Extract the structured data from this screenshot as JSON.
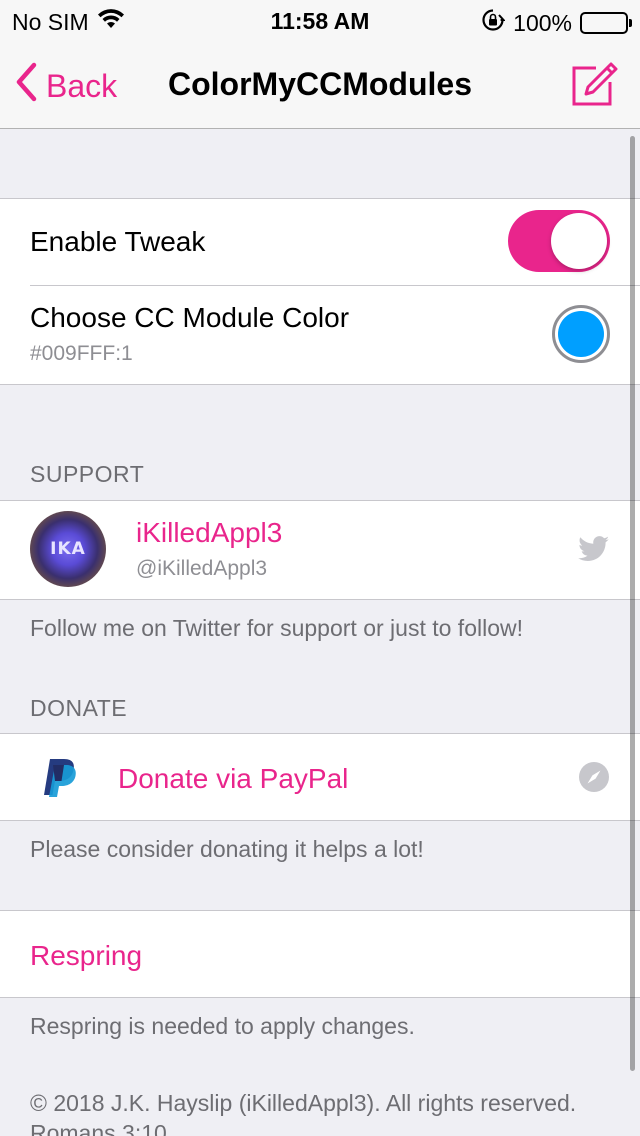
{
  "status_bar": {
    "carrier": "No SIM",
    "time": "11:58 AM",
    "battery": "100%"
  },
  "nav": {
    "back_label": "Back",
    "title": "ColorMyCCModules"
  },
  "settings": {
    "enable_label": "Enable Tweak",
    "enable_on": true,
    "color_label": "Choose CC Module Color",
    "color_value": "#009FFF:1",
    "swatch_color": "#009FFF"
  },
  "support": {
    "header": "SUPPORT",
    "avatar_text": "IKA",
    "name": "iKilledAppl3",
    "handle": "@iKilledAppl3",
    "footer": "Follow me on Twitter for support or just to follow!"
  },
  "donate": {
    "header": "DONATE",
    "label": "Donate via PayPal",
    "footer": "Please consider donating it helps a lot!"
  },
  "respring": {
    "label": "Respring",
    "footer": "Respring is needed to apply changes."
  },
  "copyright": "© 2018 J.K. Hayslip (iKilledAppl3). All rights reserved. Romans 3:10",
  "colors": {
    "accent": "#e9258c",
    "swatch": "#009FFF",
    "background": "#efeff4"
  },
  "icons": [
    "wifi-icon",
    "orientation-lock-icon",
    "battery-icon",
    "chevron-left-icon",
    "compose-icon",
    "twitter-icon",
    "paypal-icon",
    "safari-compass-icon"
  ]
}
